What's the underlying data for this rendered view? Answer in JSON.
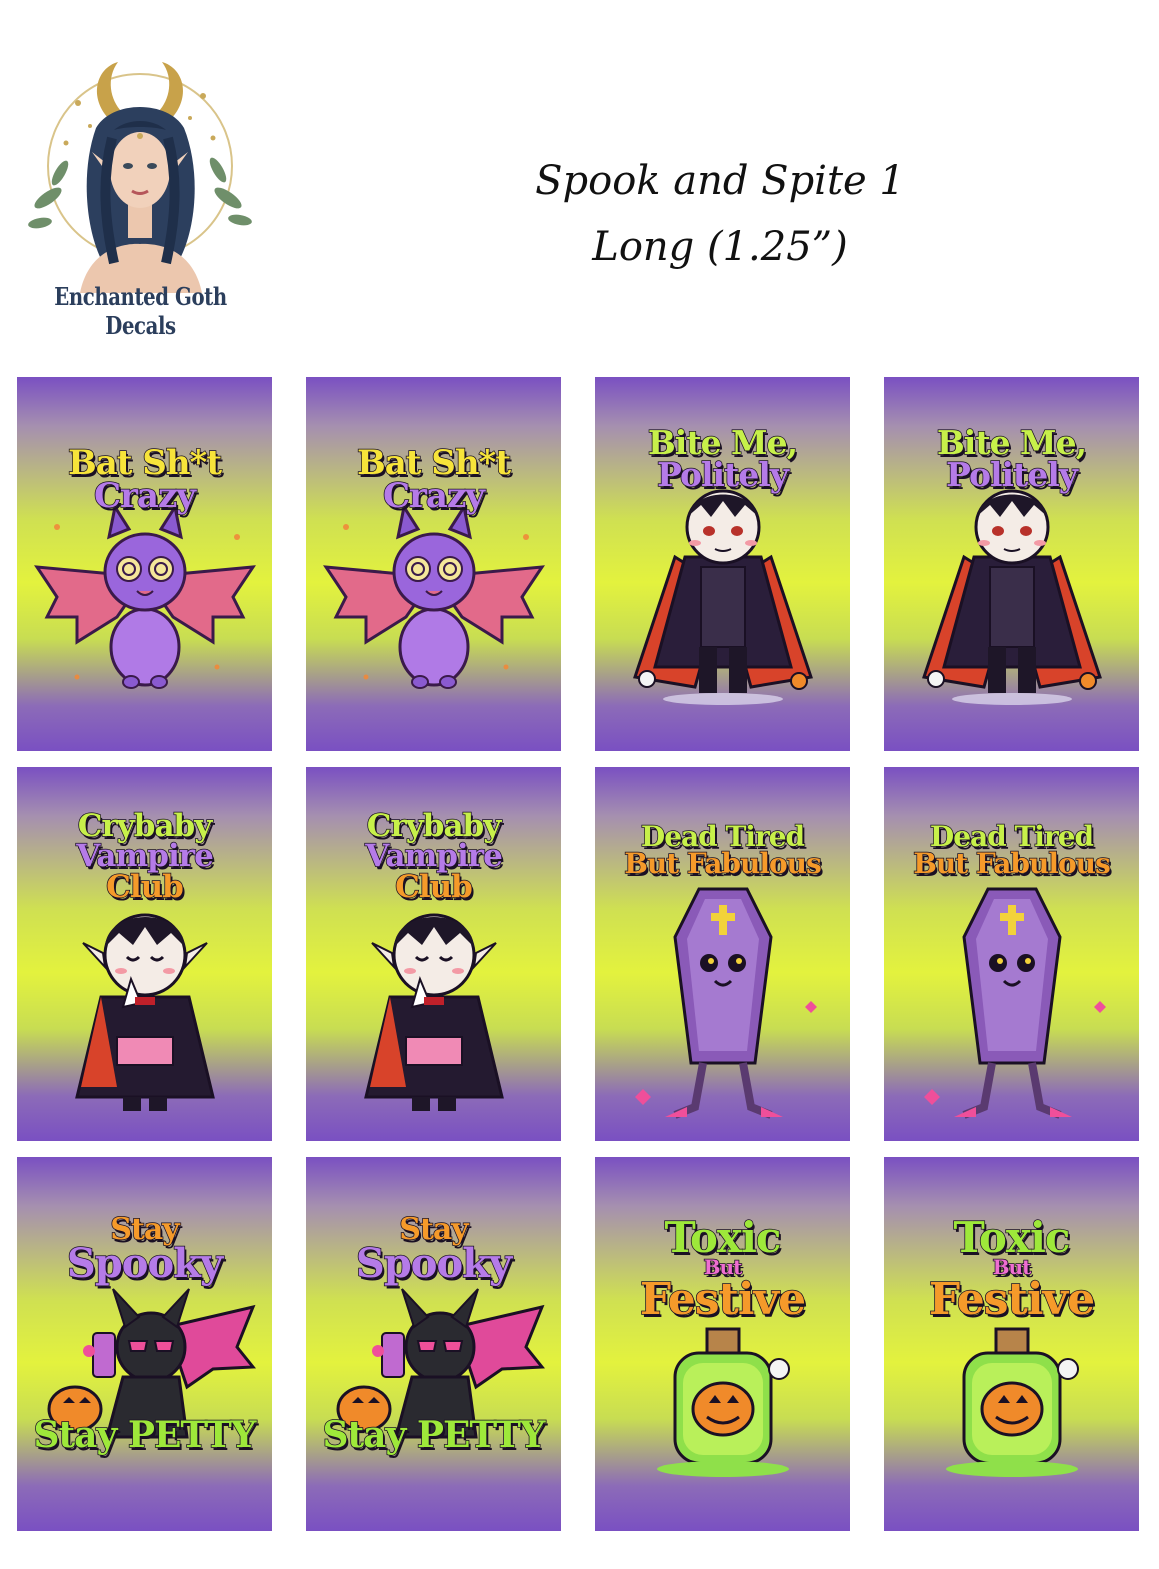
{
  "brand": {
    "name": "Enchanted Goth Decals"
  },
  "title": {
    "line1": "Spook and Spite 1",
    "line2": "Long (1.25”)"
  },
  "stickers": [
    {
      "line1": "Bat Sh*t",
      "line2": "Crazy",
      "line3": ""
    },
    {
      "line1": "Bat Sh*t",
      "line2": "Crazy",
      "line3": ""
    },
    {
      "line1": "Bite Me,",
      "line2": "Politely",
      "line3": ""
    },
    {
      "line1": "Bite Me,",
      "line2": "Politely",
      "line3": ""
    },
    {
      "line1": "Crybaby",
      "line2": "Vampire",
      "line3": "Club"
    },
    {
      "line1": "Crybaby",
      "line2": "Vampire",
      "line3": "Club"
    },
    {
      "line1": "Dead Tired",
      "line2": "But Fabulous",
      "line3": ""
    },
    {
      "line1": "Dead Tired",
      "line2": "But Fabulous",
      "line3": ""
    },
    {
      "line1": "Stay",
      "line2": "Spooky",
      "line3": "Stay PETTY"
    },
    {
      "line1": "Stay",
      "line2": "Spooky",
      "line3": "Stay PETTY"
    },
    {
      "line1": "Toxic",
      "line2": "But",
      "line3": "Festive"
    },
    {
      "line1": "Toxic",
      "line2": "But",
      "line3": "Festive"
    }
  ],
  "colors": {
    "gradient_top": "#7a50c2",
    "gradient_mid": "#e3f23e",
    "text_outline": "#1a1024"
  }
}
